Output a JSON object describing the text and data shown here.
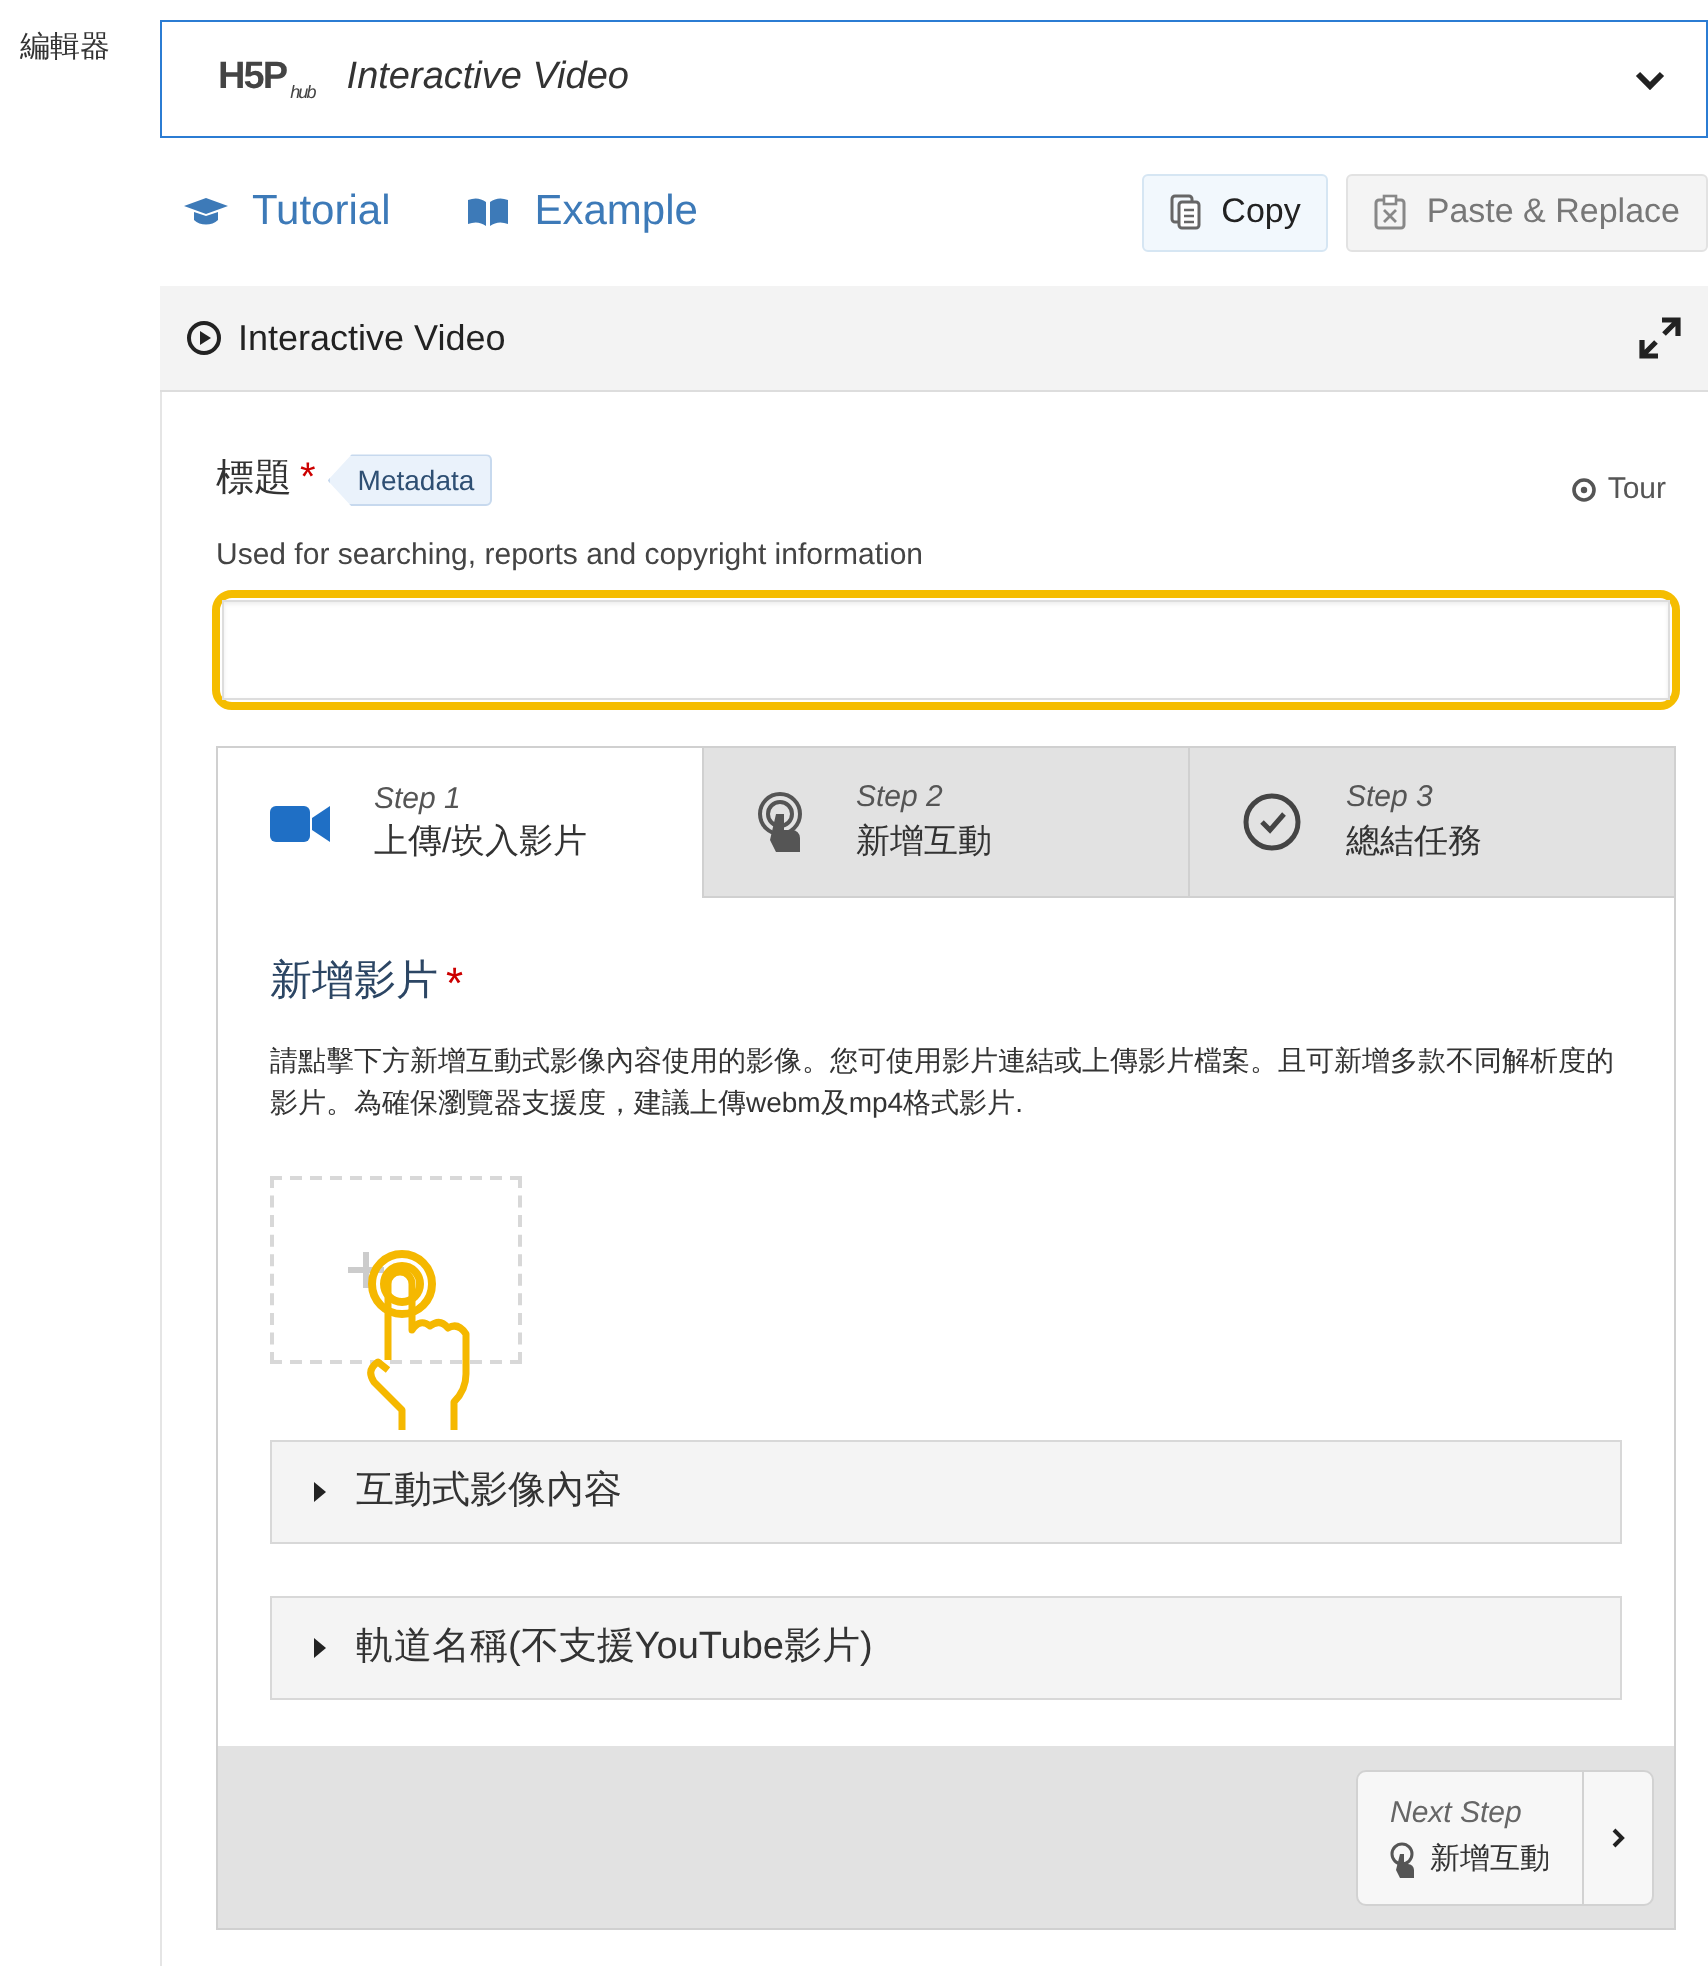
{
  "label": "編輯器",
  "selector": {
    "logo": "H5P",
    "logo_sub": "hub",
    "title": "Interactive Video"
  },
  "links": [
    {
      "kind": "tutorial",
      "label": "Tutorial"
    },
    {
      "kind": "example",
      "label": "Example"
    }
  ],
  "actions": [
    {
      "kind": "copy",
      "label": "Copy",
      "disabled": false
    },
    {
      "kind": "paste",
      "label": "Paste & Replace",
      "disabled": true
    }
  ],
  "panel": {
    "title": "Interactive Video"
  },
  "title_field": {
    "label": "標題",
    "required_mark": "*",
    "metadata": "Metadata",
    "tour": "Tour",
    "description": "Used for searching, reports and copyright information",
    "highlighted": true
  },
  "steps": [
    {
      "kind": "video",
      "step": "Step 1",
      "label": "上傳/崁入影片",
      "selected": true
    },
    {
      "kind": "touch",
      "step": "Step 2",
      "label": "新增互動",
      "selected": false
    },
    {
      "kind": "check",
      "step": "Step 3",
      "label": "總結任務",
      "selected": false
    }
  ],
  "video_section": {
    "heading": "新增影片",
    "required_mark": "*",
    "description": "請點擊下方新增互動式影像內容使用的影像。您可使用影片連結或上傳影片檔案。且可新增多款不同解析度的影片。為確保瀏覽器支援度，建議上傳webm及mp4格式影片."
  },
  "groups": [
    {
      "label": "互動式影像內容",
      "expanded": false
    },
    {
      "label": "軌道名稱(不支援YouTube影片)",
      "expanded": false
    }
  ],
  "next": {
    "caption": "Next Step",
    "label": "新增互動"
  }
}
